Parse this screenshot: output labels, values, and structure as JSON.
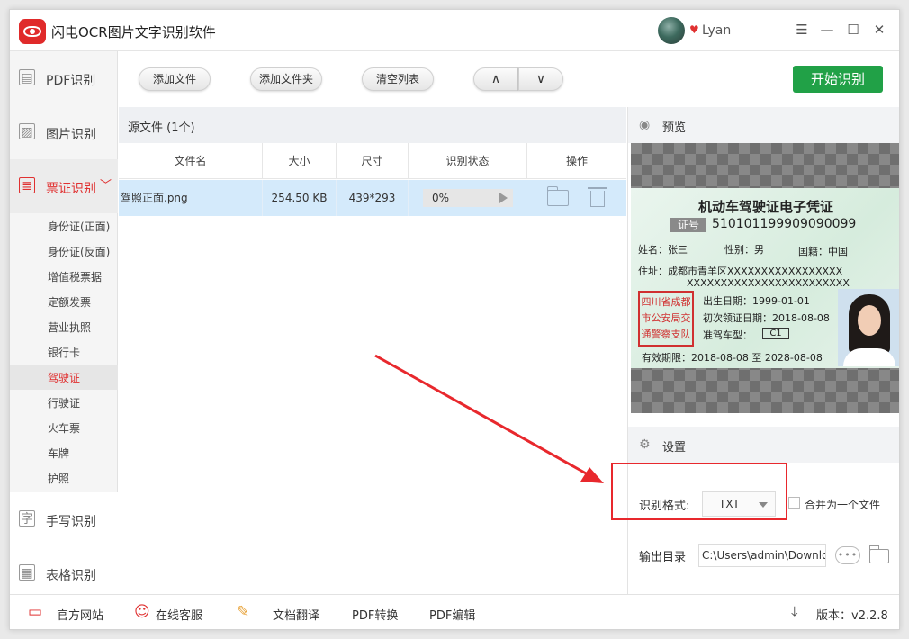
{
  "app": {
    "title": "闪电OCR图片文字识别软件",
    "username": "Lyan",
    "accent_color": "#e03131",
    "start_color": "#21a147"
  },
  "sidebar": {
    "main": [
      {
        "label": "PDF识别",
        "icon": "pdf-icon"
      },
      {
        "label": "图片识别",
        "icon": "image-icon"
      },
      {
        "label": "票证识别",
        "icon": "ticket-icon",
        "active": true
      },
      {
        "label": "手写识别",
        "icon": "handwriting-icon"
      },
      {
        "label": "表格识别",
        "icon": "table-icon"
      }
    ],
    "sub": [
      "身份证(正面)",
      "身份证(反面)",
      "增值税票据",
      "定额发票",
      "营业执照",
      "银行卡",
      "驾驶证",
      "行驶证",
      "火车票",
      "车牌",
      "护照"
    ],
    "active_sub": "驾驶证"
  },
  "toolbar": {
    "add_file": "添加文件",
    "add_folder": "添加文件夹",
    "clear_list": "清空列表",
    "up": "∧",
    "down": "∨",
    "start": "开始识别"
  },
  "files": {
    "section_title": "源文件 (1个)",
    "columns": [
      "文件名",
      "大小",
      "尺寸",
      "识别状态",
      "操作"
    ],
    "rows": [
      {
        "name": "驾照正面.png",
        "size": "254.50 KB",
        "dimensions": "439*293",
        "progress": "0%",
        "progress_value": 0
      }
    ]
  },
  "preview": {
    "title": "预览",
    "card": {
      "title": "机动车驾驶证电子凭证",
      "license_label": "证号",
      "license_number": "510101199909090099",
      "name": "姓名：张三",
      "gender": "性别：男",
      "nationality": "国籍：中国",
      "address1": "住址：成都市青羊区XXXXXXXXXXXXXXXXX",
      "address2": "XXXXXXXXXXXXXXXXXXXXXXXX",
      "stamp": [
        "四川省成都",
        "市公安局交",
        "通警察支队"
      ],
      "birth": "出生日期：1999-01-01",
      "first_issue": "初次领证日期：2018-08-08",
      "class_label": "准驾车型：",
      "class": "C1",
      "validity": "有效期限：2018-08-08 至 2028-08-08"
    }
  },
  "settings": {
    "title": "设置",
    "format_label": "识别格式:",
    "format_value": "TXT",
    "merge_label": "合并为一个文件",
    "merge_checked": false,
    "output_label": "输出目录",
    "output_value": "C:\\Users\\admin\\Downloads",
    "browse_label": "•••"
  },
  "footer": {
    "website": "官方网站",
    "service": "在线客服",
    "translate": "文档翻译",
    "pdf_convert": "PDF转换",
    "pdf_edit": "PDF编辑",
    "version": "版本：v2.2.8"
  }
}
